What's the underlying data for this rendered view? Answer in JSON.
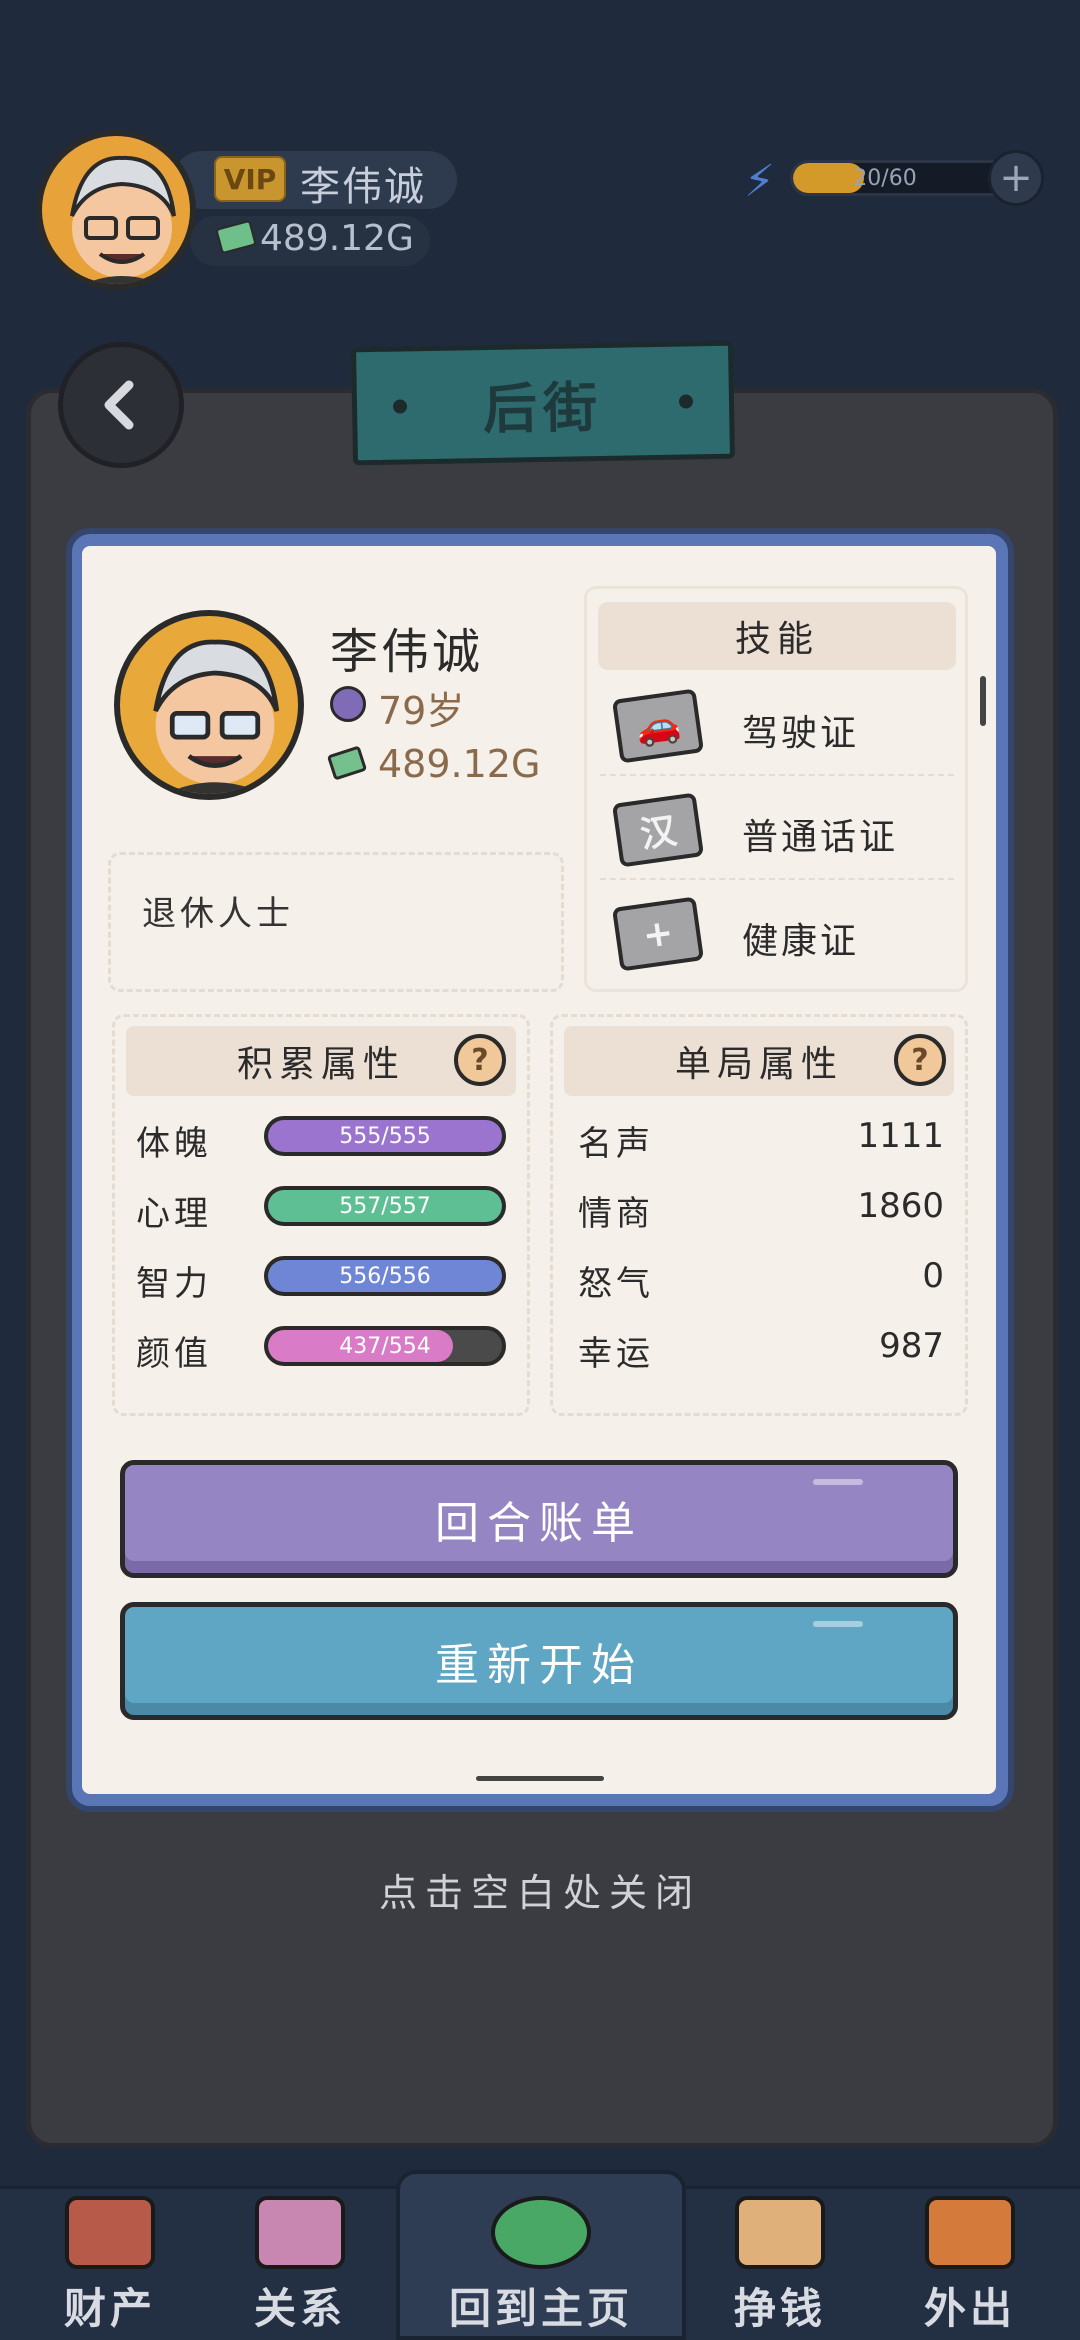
{
  "header": {
    "vip": "VIP",
    "player_name": "李伟诚",
    "money": "489.12G",
    "energy_text": "20/60",
    "energy_fraction": 0.333,
    "plus_label": "+"
  },
  "page": {
    "title": "后街"
  },
  "profile": {
    "name": "李伟诚",
    "age": "79岁",
    "money": "489.12G",
    "bio": "退休人士"
  },
  "skills": {
    "title": "技能",
    "items": [
      {
        "label": "驾驶证",
        "icon": "car-icon",
        "glyph": "🚗"
      },
      {
        "label": "普通话证",
        "icon": "han-character-icon",
        "glyph": "汉"
      },
      {
        "label": "健康证",
        "icon": "plus-icon",
        "glyph": "+"
      }
    ]
  },
  "cumulative": {
    "title": "积累属性",
    "help": "?",
    "rows": [
      {
        "label": "体魄",
        "value": "555/555",
        "fraction": 1.0,
        "color": "#9a74cf"
      },
      {
        "label": "心理",
        "value": "557/557",
        "fraction": 1.0,
        "color": "#5ebf95"
      },
      {
        "label": "智力",
        "value": "556/556",
        "fraction": 1.0,
        "color": "#6f86d6"
      },
      {
        "label": "颜值",
        "value": "437/554",
        "fraction": 0.789,
        "color": "#d97bc7"
      }
    ]
  },
  "session": {
    "title": "单局属性",
    "help": "?",
    "rows": [
      {
        "label": "名声",
        "value": "1111"
      },
      {
        "label": "情商",
        "value": "1860"
      },
      {
        "label": "怒气",
        "value": "0"
      },
      {
        "label": "幸运",
        "value": "987"
      }
    ]
  },
  "buttons": {
    "round_bill": "回合账单",
    "restart": "重新开始"
  },
  "close_hint": "点击空白处关闭",
  "nav": {
    "items": [
      {
        "label": "财产",
        "icon": "house-icon",
        "color": "#b85a4a"
      },
      {
        "label": "关系",
        "icon": "contacts-book-icon",
        "color": "#c887b0"
      },
      {
        "label": "回到主页",
        "icon": "return-arrow-icon",
        "color": "#4aa867"
      },
      {
        "label": "挣钱",
        "icon": "money-fist-icon",
        "color": "#e0b07a"
      },
      {
        "label": "外出",
        "icon": "door-exit-icon",
        "color": "#d47a3a"
      }
    ]
  }
}
